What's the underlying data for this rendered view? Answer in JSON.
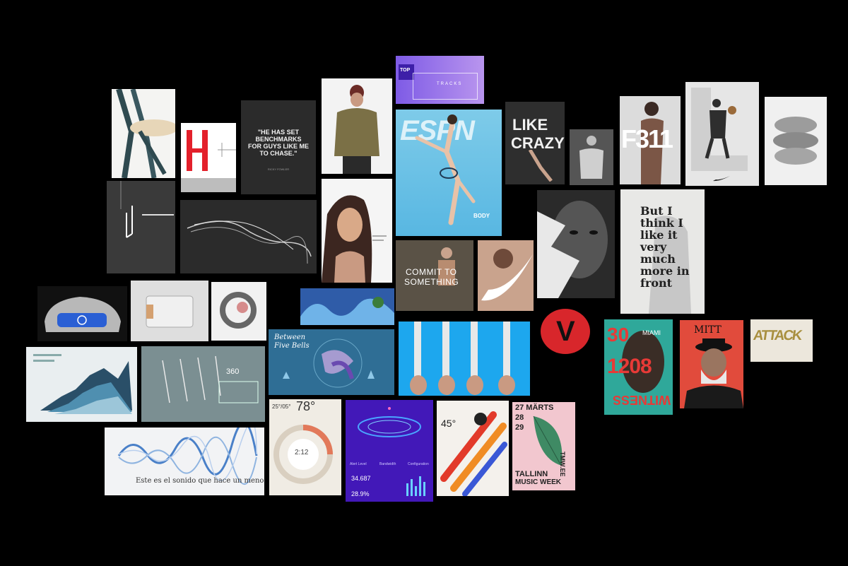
{
  "colors": {
    "background": "#000000",
    "accent_blue": "#2a7fd0",
    "accent_red": "#d8262b",
    "accent_purple": "#4b1fbf"
  },
  "tiles": {
    "top_tracks": {
      "line1": "TOP",
      "line2": "TRACKS"
    },
    "quote": {
      "text": "\"HE HAS SET BENCHMARKS FOR GUYS LIKE ME TO CHASE.\"",
      "byline": "RICKY FOWLER"
    },
    "espn": {
      "logo": "ESPN",
      "sub": "BODY"
    },
    "like_crazy": {
      "line1": "LIKE",
      "line2": "CRAZY"
    },
    "f311": {
      "text": "F311"
    },
    "but_i_think": {
      "text": "But I think I like it very much more in front"
    },
    "commit": {
      "line1": "COMMIT TO",
      "line2": "SOMETHING"
    },
    "v_logo": {
      "letter": "V"
    },
    "miami": {
      "n1": "30",
      "city": "MIAMI",
      "n2": "1208",
      "word": "WITNESS"
    },
    "mitt": {
      "text": "MITT"
    },
    "attack": {
      "text": "ATTACK"
    },
    "bells": {
      "line1": "Between",
      "line2": "Five Bells"
    },
    "weather": {
      "temp_small": "25°/05°",
      "temp_big": "78°",
      "dial": "2:12"
    },
    "app_stats": {
      "tab1": "Alert Level",
      "tab2": "Bandwidth",
      "tab3": "Configuration",
      "val1": "34.687",
      "val2": "28.9%"
    },
    "poster45": {
      "text": "45°"
    },
    "tallinn": {
      "date1": "27 MÄRTS",
      "date2": "28",
      "date3": "29",
      "title1": "TALLINN",
      "title2": "MUSIC WEEK",
      "site": "TMW.EE"
    },
    "wave": {
      "caption": "Este es el sonido que hace un meno"
    },
    "chart3d": {
      "label": "360"
    }
  }
}
